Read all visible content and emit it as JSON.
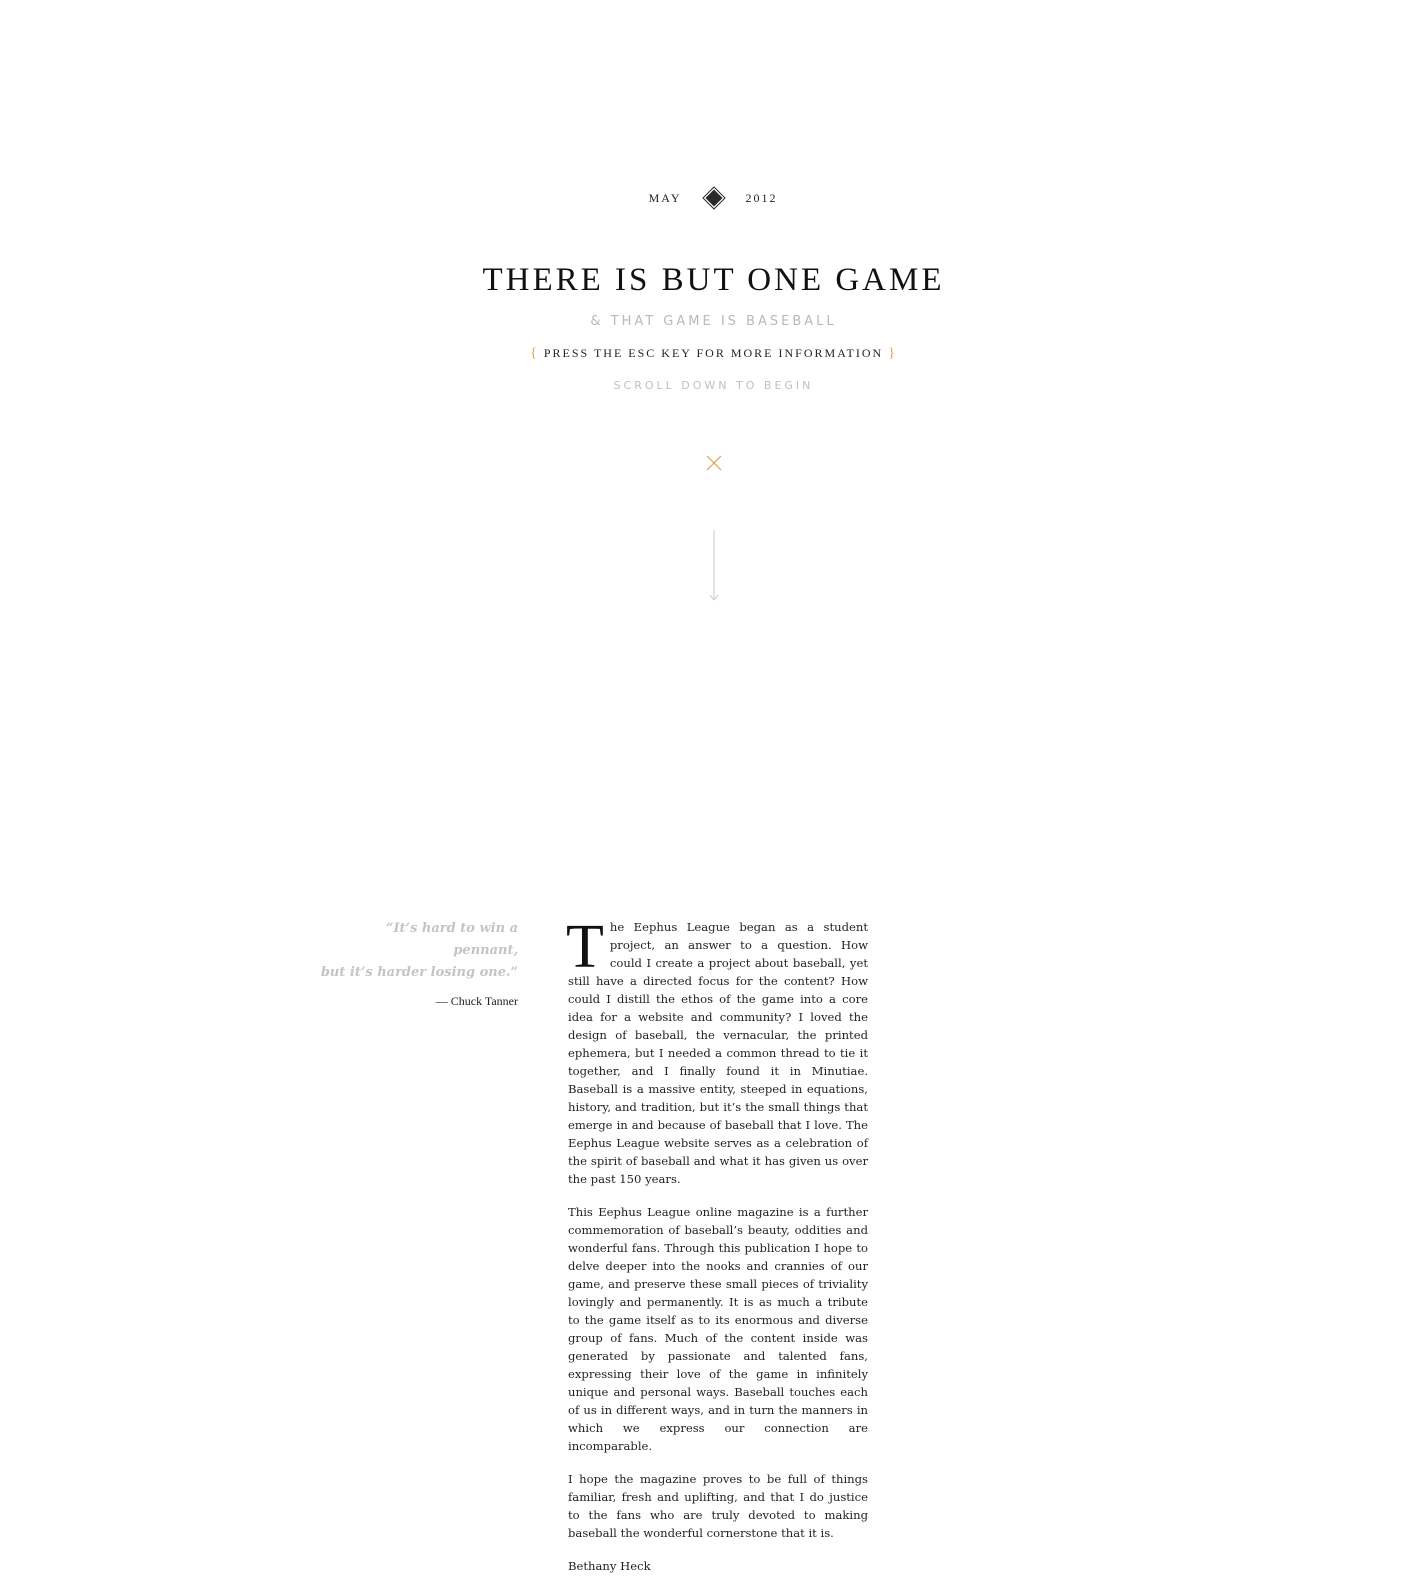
{
  "dateline": {
    "month": "MAY",
    "year": "2012",
    "separator_icon": "diamond-icon"
  },
  "title": "THERE IS BUT ONE GAME",
  "subtitle": "& THAT GAME IS BASEBALL",
  "esc_hint": {
    "open_brace": "{",
    "text": "PRESS THE ESC KEY FOR MORE INFORMATION",
    "close_brace": "}"
  },
  "scroll_hint": "SCROLL DOWN TO BEGIN",
  "icons": {
    "close": "close-icon",
    "arrow": "arrow-down-icon"
  },
  "colors": {
    "accent": "#e0a24a",
    "muted": "#b9b9b9",
    "text": "#222222"
  },
  "quote": {
    "line1": "“It’s hard to win a pennant,",
    "line2": "but it’s harder losing one.”",
    "author": "— Chuck Tanner"
  },
  "article": {
    "dropcap": "T",
    "p1": "he Eephus League began as a student project, an answer to a question. How could I create a project about baseball, yet still have a directed focus for the content? How could I distill the ethos of the game into a core idea for a website and community? I loved the design of baseball, the vernacular, the printed ephemera, but I needed a common thread to tie it together, and I finally found it in Minutiae. Baseball is a massive entity, steeped in equations, history, and tradition, but it’s the small things that emerge in and because of baseball that I love. The Eephus League website serves as a celebration of the spirit of baseball and what it has given us over the past 150 years.",
    "p2": "This Eephus League online magazine is a further commemoration of baseball’s beauty, oddities and wonderful fans. Through this publication I hope to delve deeper into the nooks and crannies of our game, and preserve these small pieces of triviality lovingly and permanently. It is as much a tribute to the game itself as to its enormous and diverse group of fans. Much of the content inside was generated by passionate and talented fans, expressing their love of the game in infinitely unique and personal ways. Baseball touches each of us in different ways, and in turn the manners in which we express our connection are incomparable.",
    "p3": "I hope the magazine proves to be full of things familiar, fresh and uplifting, and that I do justice to the fans who are truly devoted to making baseball the wonderful cornerstone that it is.",
    "signature": "Bethany Heck"
  }
}
